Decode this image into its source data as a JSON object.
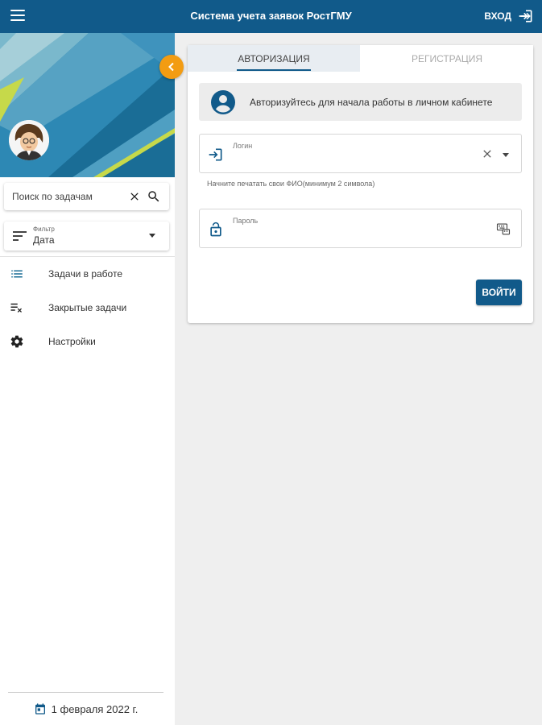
{
  "header": {
    "title": "Система учета заявок РостГМУ",
    "login_label": "ВХОД"
  },
  "sidebar": {
    "search": {
      "placeholder": "Поиск по задачам",
      "value": ""
    },
    "filter": {
      "label": "Фильтр",
      "value": "Дата"
    },
    "nav_items": [
      {
        "label": "Задачи в работе",
        "icon": "list-icon"
      },
      {
        "label": "Закрытые задачи",
        "icon": "clear-list-icon"
      },
      {
        "label": "Настройки",
        "icon": "gear-icon"
      }
    ],
    "date": "1 февраля 2022 г."
  },
  "main": {
    "tabs": [
      {
        "label": "АВТОРИЗАЦИЯ",
        "active": true
      },
      {
        "label": "РЕГИСТРАЦИЯ",
        "active": false
      }
    ],
    "info_text": "Авторизуйтесь для начала работы в личном кабинете",
    "login_field": {
      "label": "Логин",
      "value": "",
      "hint": "Начните печатать свои ФИО(минимум 2 символа)"
    },
    "password_field": {
      "label": "Пароль",
      "value": ""
    },
    "submit_label": "ВОЙТИ"
  },
  "colors": {
    "primary": "#115a8a",
    "accent": "#f39c12",
    "background": "#efefef"
  }
}
